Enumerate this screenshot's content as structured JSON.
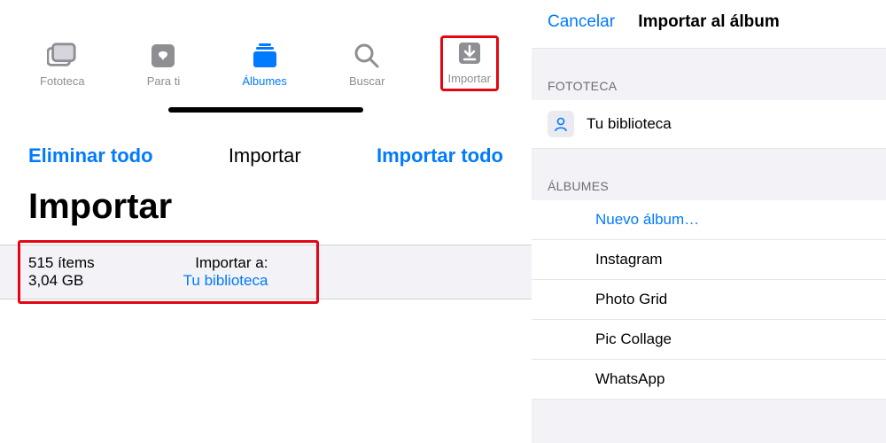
{
  "tabs": {
    "fototeca": "Fototeca",
    "parati": "Para ti",
    "albumes": "Álbumes",
    "buscar": "Buscar",
    "importar": "Importar"
  },
  "actions": {
    "delete_all": "Eliminar todo",
    "import_center": "Importar",
    "import_all": "Importar todo"
  },
  "page_title": "Importar",
  "info": {
    "items": "515 ítems",
    "size": "3,04 GB",
    "import_to_label": "Importar a:",
    "import_to_value": "Tu biblioteca"
  },
  "right": {
    "cancel": "Cancelar",
    "title": "Importar al álbum",
    "section_fototeca": "FOTOTECA",
    "your_library": "Tu biblioteca",
    "section_albumes": "ÁLBUMES",
    "new_album": "Nuevo álbum…",
    "albums": {
      "instagram": "Instagram",
      "photogrid": "Photo Grid",
      "piccollage": "Pic Collage",
      "whatsapp": "WhatsApp"
    }
  }
}
